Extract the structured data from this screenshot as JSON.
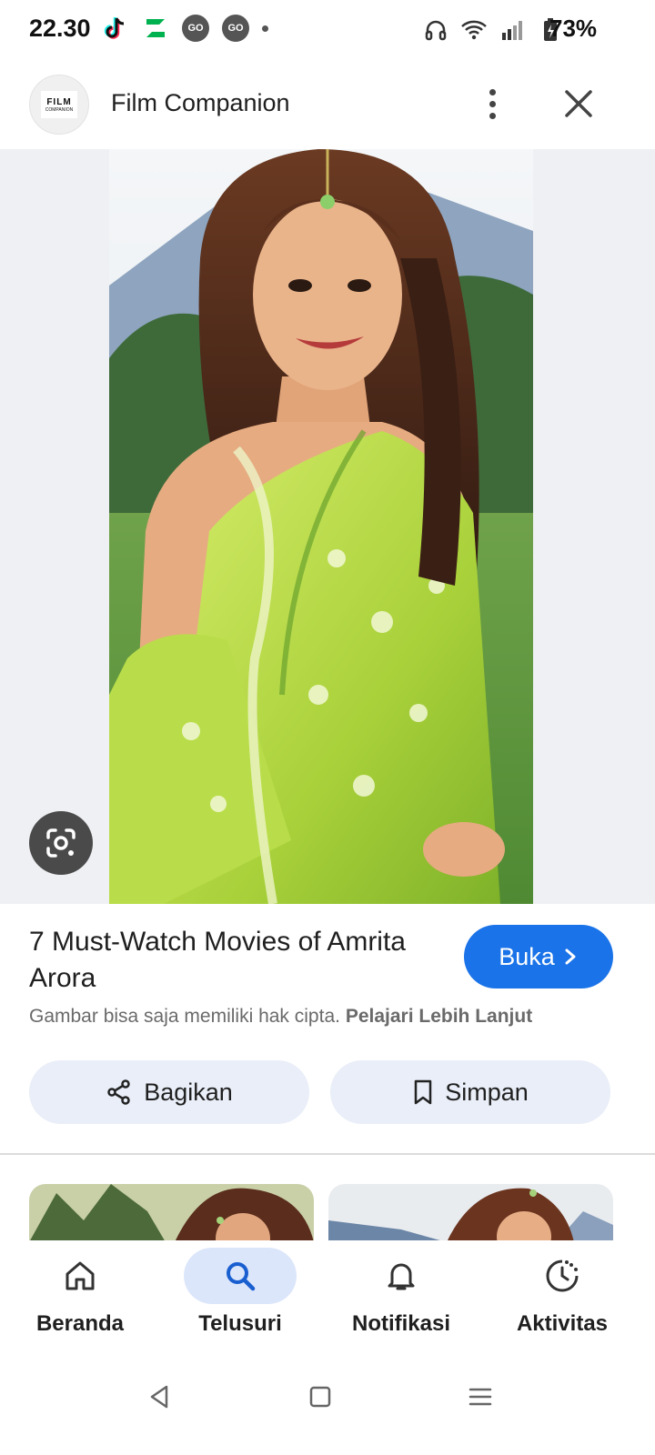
{
  "status_bar": {
    "time": "22.30",
    "battery": "73%",
    "left_icons": [
      "tiktok-icon",
      "app-z-icon",
      "go-icon",
      "go-icon",
      "dot"
    ],
    "right_icons": [
      "headphones-icon",
      "wifi-icon",
      "signal-icon",
      "battery-charging-icon"
    ],
    "go_label": "GO"
  },
  "header": {
    "site_name": "Film Companion",
    "logo_text": "FILM",
    "logo_subtext": "COMPANION"
  },
  "result": {
    "title": "7 Must-Watch Movies of Amrita Arora",
    "open_label": "Buka",
    "copyright_text": "Gambar bisa saja memiliki hak cipta.",
    "learn_more": "Pelajari Lebih Lanjut"
  },
  "actions": {
    "share_label": "Bagikan",
    "save_label": "Simpan"
  },
  "bottom_nav": {
    "items": [
      {
        "label": "Beranda",
        "icon": "home-icon",
        "active": false
      },
      {
        "label": "Telusuri",
        "icon": "search-icon",
        "active": true
      },
      {
        "label": "Notifikasi",
        "icon": "bell-icon",
        "active": false
      },
      {
        "label": "Aktivitas",
        "icon": "activity-icon",
        "active": false
      }
    ]
  },
  "colors": {
    "accent": "#1a73e8",
    "chip_bg": "#e9eef8",
    "active_nav_bg": "#dce6fb"
  }
}
